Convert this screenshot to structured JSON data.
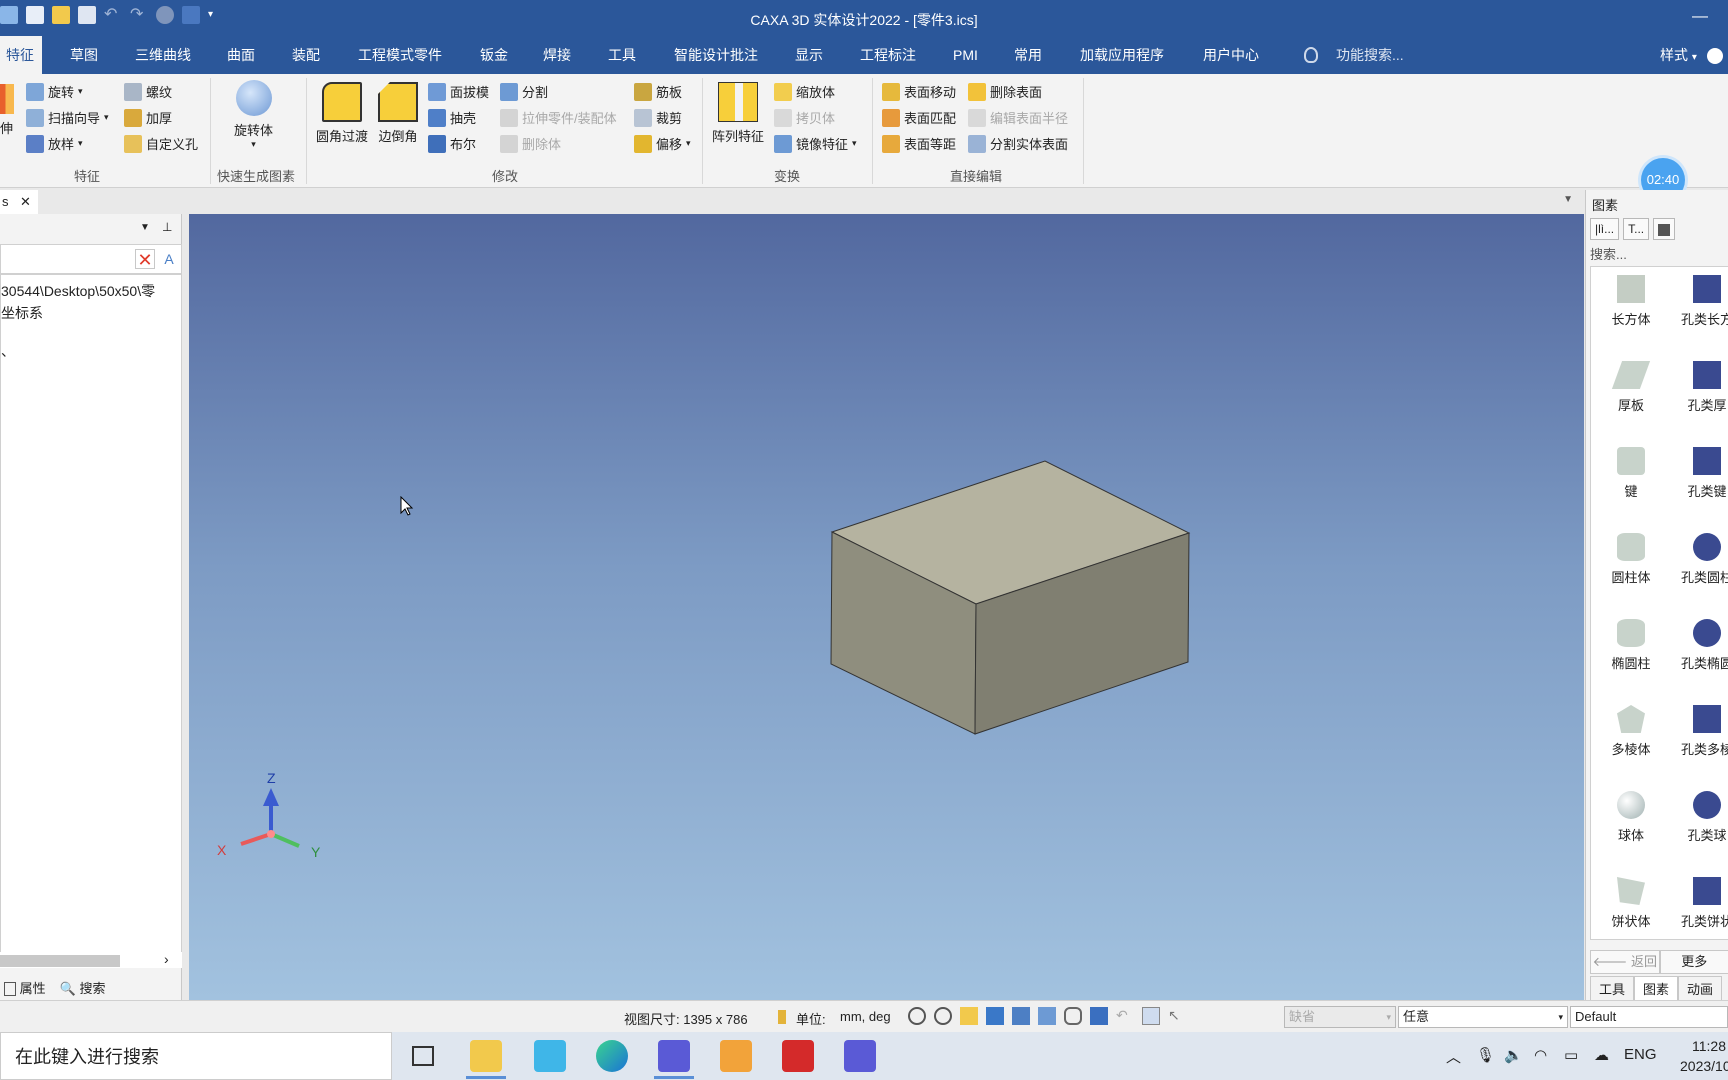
{
  "window": {
    "title": "CAXA 3D 实体设计2022 - [零件3.ics]",
    "minimize_glyph": "—"
  },
  "menu": {
    "tabs": [
      "特征",
      "草图",
      "三维曲线",
      "曲面",
      "装配",
      "工程模式零件",
      "钣金",
      "焊接",
      "工具",
      "智能设计批注",
      "显示",
      "工程标注",
      "PMI",
      "常用",
      "加载应用程序",
      "用户中心"
    ],
    "function_search": "功能搜索...",
    "style": "样式"
  },
  "ribbon": {
    "feature_group": {
      "label": "特征",
      "stretch_partial": "伸",
      "revolve": "旋转",
      "sweep": "扫描向导",
      "loft": "放样",
      "thread": "螺纹",
      "thicken": "加厚",
      "custom_hole": "自定义孔"
    },
    "quick_group": {
      "label": "快速生成图素",
      "revolve_body": "旋转体"
    },
    "modify_group": {
      "label": "修改",
      "fillet": "圆角过渡",
      "chamfer": "边倒角",
      "face_draft": "面拔模",
      "shell": "抽壳",
      "boolean": "布尔",
      "split": "分割",
      "stretch_part": "拉伸零件/装配体",
      "delete_body": "删除体",
      "rib": "筋板",
      "trim": "裁剪",
      "offset": "偏移"
    },
    "transform_group": {
      "label": "变换",
      "pattern": "阵列特征",
      "scale": "缩放体",
      "copy": "拷贝体",
      "mirror": "镜像特征"
    },
    "direct_edit_group": {
      "label": "直接编辑",
      "face_move": "表面移动",
      "face_match": "表面匹配",
      "face_offset": "表面等距",
      "delete_face": "删除表面",
      "edit_radius": "编辑表面半径",
      "split_solid_face": "分割实体表面"
    },
    "timer": "02:40"
  },
  "document_tab": {
    "label": "s",
    "close": "✕"
  },
  "left_panel": {
    "tree": [
      "30544\\Desktop\\50x50\\零",
      "坐标系",
      "、"
    ],
    "properties": "属性",
    "search": "搜索"
  },
  "viewport": {
    "axis_z": "Z",
    "axis_x": "X",
    "axis_y": "Y"
  },
  "right_panel": {
    "title": "图素",
    "tabs": [
      "|lì...",
      "T...",
      ""
    ],
    "search_placeholder": "搜索...",
    "items_left": [
      "长方体",
      "厚板",
      "键",
      "圆柱体",
      "椭圆柱",
      "多棱体",
      "球体",
      "饼状体"
    ],
    "items_right": [
      "孔类长方",
      "孔类厚",
      "孔类键",
      "孔类圆柱",
      "孔类椭圆",
      "孔类多棱",
      "孔类球",
      "孔类饼状"
    ],
    "back": "返回",
    "more": "更多",
    "bottom_tabs": [
      "工具",
      "图素",
      "动画"
    ]
  },
  "status_bar": {
    "view_size": "视图尺寸: 1395 x  786",
    "unit_label": "单位:",
    "unit_value": "mm, deg",
    "default_disabled": "缺省",
    "any": "任意",
    "default": "Default"
  },
  "taskbar": {
    "search_text": "在此键入进行搜索",
    "lang": "ENG",
    "time": "11:28",
    "date": "2023/10"
  },
  "colors": {
    "brand_blue": "#2b579a",
    "viewport_top": "#52689f",
    "viewport_bottom": "#a2c2df",
    "box_top": "#b5b3a0",
    "box_front": "#8f8e7e",
    "box_side": "#807f71"
  }
}
